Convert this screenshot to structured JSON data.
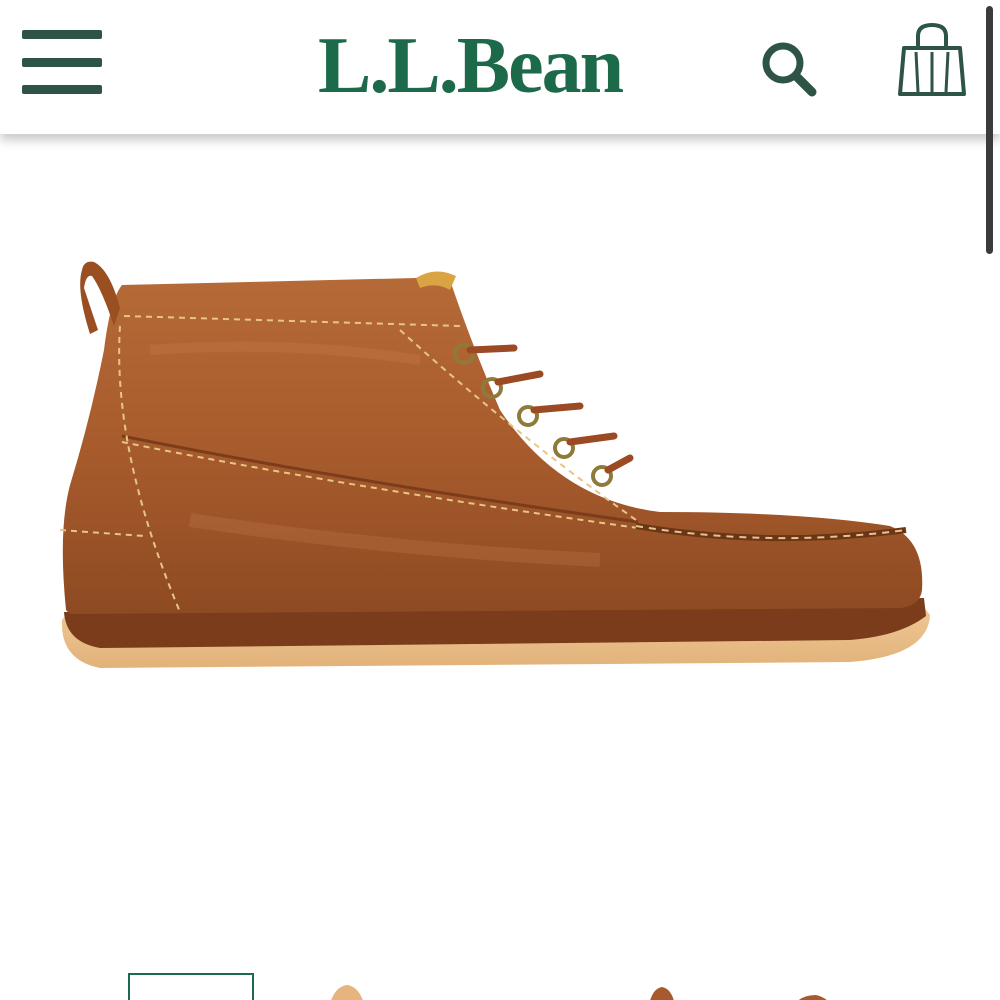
{
  "header": {
    "logo_text": "L.L.Bean",
    "menu_icon": "hamburger-menu-icon",
    "search_icon": "search-icon",
    "bag_icon": "shopping-bag-icon"
  },
  "colors": {
    "brand_green": "#1d6a4a",
    "icon_green": "#2e5446",
    "leather": "#a65a2e",
    "sole": "#e9bf8c"
  },
  "product": {
    "image": "brown-leather-chukka-boot-image"
  },
  "thumbnails": [
    {
      "selected": true
    },
    {
      "selected": false
    },
    {
      "selected": false
    },
    {
      "selected": false
    }
  ]
}
